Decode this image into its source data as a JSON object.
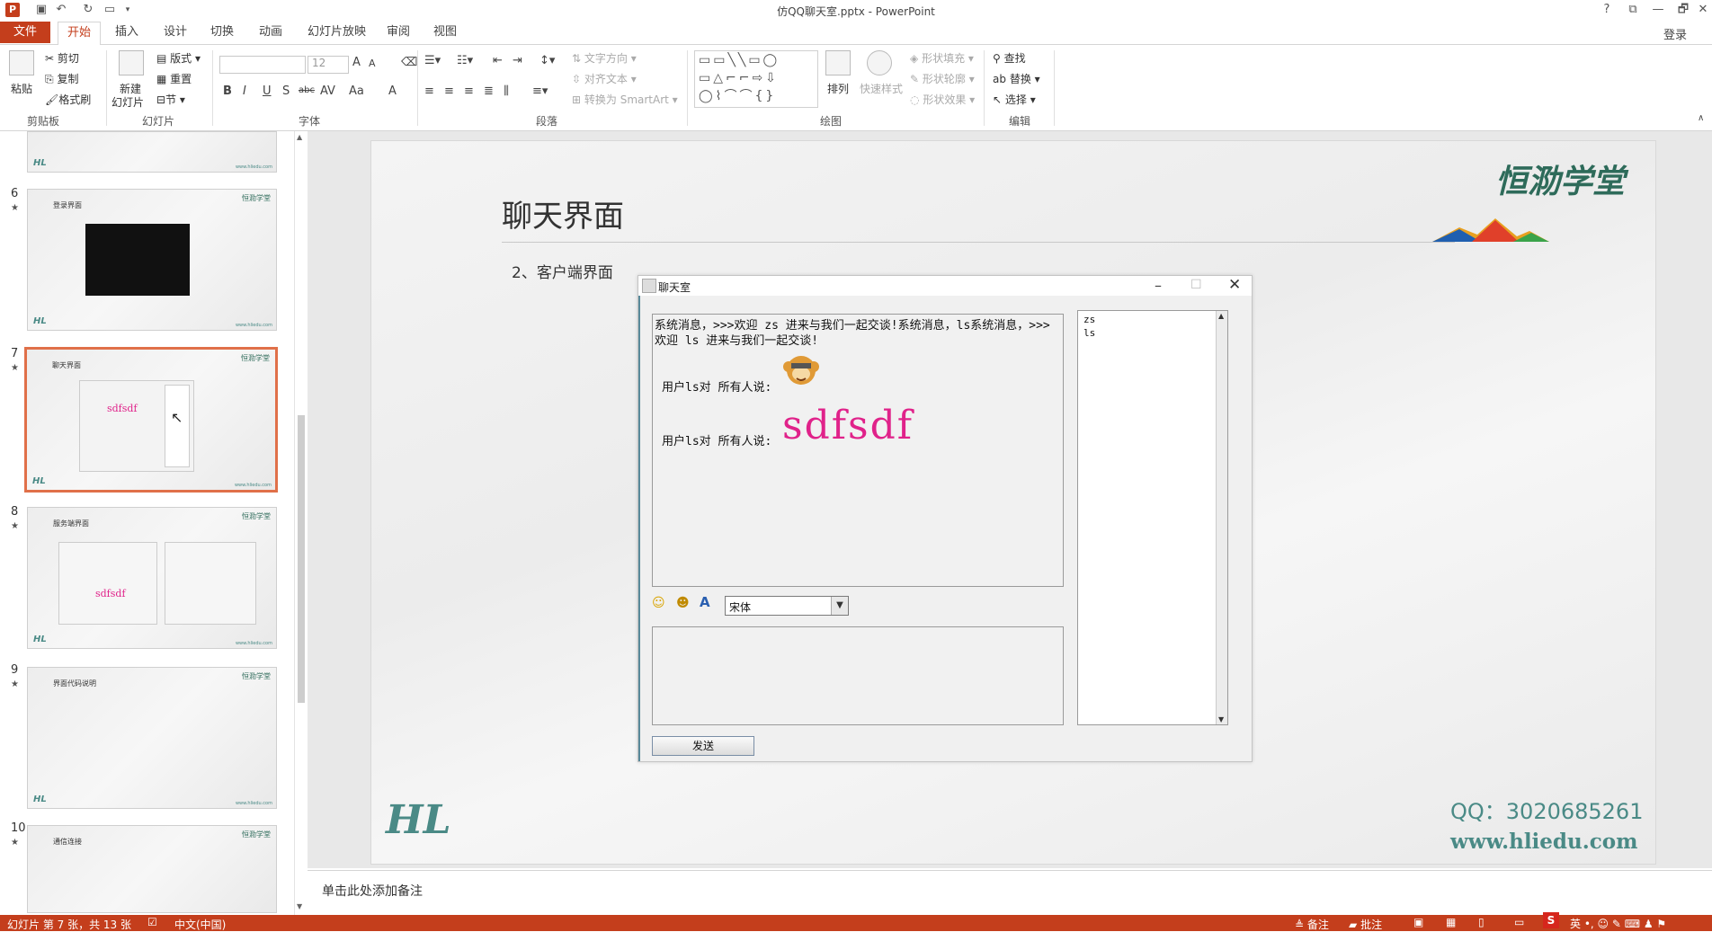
{
  "app": {
    "window_title": "仿QQ聊天室.pptx - PowerPoint",
    "title_buttons": [
      "?",
      "⧉",
      "—",
      "🗗",
      "✕"
    ],
    "login": "登录"
  },
  "tabs": [
    "文件",
    "开始",
    "插入",
    "设计",
    "切换",
    "动画",
    "幻灯片放映",
    "审阅",
    "视图"
  ],
  "ribbon": {
    "clipboard": {
      "paste": "粘贴",
      "cut": "剪切",
      "copy": "复制",
      "format_painter": "格式刷",
      "label": "剪贴板"
    },
    "slides": {
      "new_slide": "新建",
      "new_slide2": "幻灯片",
      "layout": "版式",
      "reset": "重置",
      "section": "节",
      "label": "幻灯片"
    },
    "font": {
      "font_name": "",
      "font_size": "12",
      "label": "字体",
      "bold": "B",
      "italic": "I",
      "underline": "U",
      "shadow": "S",
      "strike": "abc",
      "spacing": "AV",
      "case": "Aa",
      "color": "A",
      "grow": "A",
      "shrink": "A"
    },
    "paragraph": {
      "text_direction": "文字方向",
      "align_text": "对齐文本",
      "smartart": "转换为 SmartArt",
      "label": "段落"
    },
    "drawing": {
      "arrange": "排列",
      "quick_styles": "快速样式",
      "shape_fill": "形状填充",
      "shape_outline": "形状轮廓",
      "shape_effects": "形状效果",
      "label": "绘图"
    },
    "editing": {
      "find": "查找",
      "replace": "替换",
      "select": "选择",
      "label": "编辑"
    }
  },
  "thumbnails": [
    {
      "num": "6",
      "title": "登录界面"
    },
    {
      "num": "7",
      "title": "聊天界面",
      "big": "sdfsdf"
    },
    {
      "num": "8",
      "title": "服务端界面",
      "big": "sdfsdf"
    },
    {
      "num": "9",
      "title": "界面代码说明"
    },
    {
      "num": "10",
      "title": "通信连接"
    }
  ],
  "thumb_common": {
    "logo": "恒泐学堂",
    "hl": "HL",
    "url": "www.hliedu.com"
  },
  "slide": {
    "title": "聊天界面",
    "subtitle": "2、客户端界面",
    "logo": "恒泐学堂",
    "qq": "QQ：3020685261",
    "url": "www.hliedu.com",
    "hl": "HL"
  },
  "chat": {
    "window_title": "聊天室",
    "system_msg": "系统消息，>>>欢迎 zs 进来与我们一起交谈!系统消息，ls系统消息，>>>欢迎 ls 进来与我们一起交谈!",
    "msg1_prefix": "用户ls对 所有人说:",
    "msg2_prefix": "用户ls对 所有人说:",
    "msg2_text": "sdfsdf",
    "font_select": "宋体",
    "send_button": "发送",
    "users": [
      "zs",
      "ls"
    ]
  },
  "notes": {
    "placeholder": "单击此处添加备注"
  },
  "status": {
    "slide_info": "幻灯片 第 7 张，共 13 张",
    "language": "中文(中国)",
    "notes": "备注",
    "comments": "批注"
  },
  "colors": {
    "accent": "#c43e1c",
    "magenta": "#e0228a",
    "teal": "#2e6b5a"
  }
}
